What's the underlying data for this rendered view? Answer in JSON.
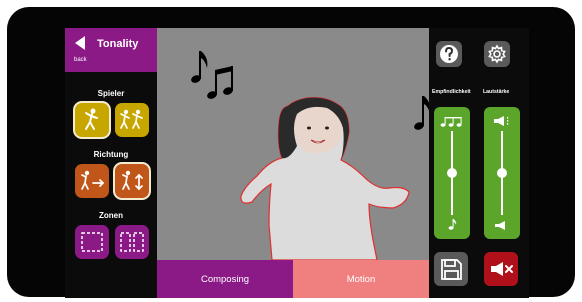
{
  "header": {
    "title": "Tonality",
    "back_label": "back"
  },
  "sections": {
    "player": "Spieler",
    "direction": "Richtung",
    "zones": "Zonen"
  },
  "tabs": {
    "composing": "Composing",
    "motion": "Motion"
  },
  "sliders": {
    "sensitivity": {
      "label": "Empfindlichkeit",
      "level": 0.5
    },
    "volume": {
      "label": "Lautstärke",
      "level": 0.5
    }
  },
  "icons": {
    "help": "question-icon",
    "settings": "gear-icon",
    "save": "floppy-disk-icon",
    "mute": "mute-speaker-icon",
    "notes": "music-notes-icon"
  },
  "colors": {
    "purple": "#8b1a86",
    "yellow": "#c8a600",
    "orange": "#c0561a",
    "green": "#5aa52a",
    "pink": "#f08080",
    "red": "#b0101a"
  }
}
